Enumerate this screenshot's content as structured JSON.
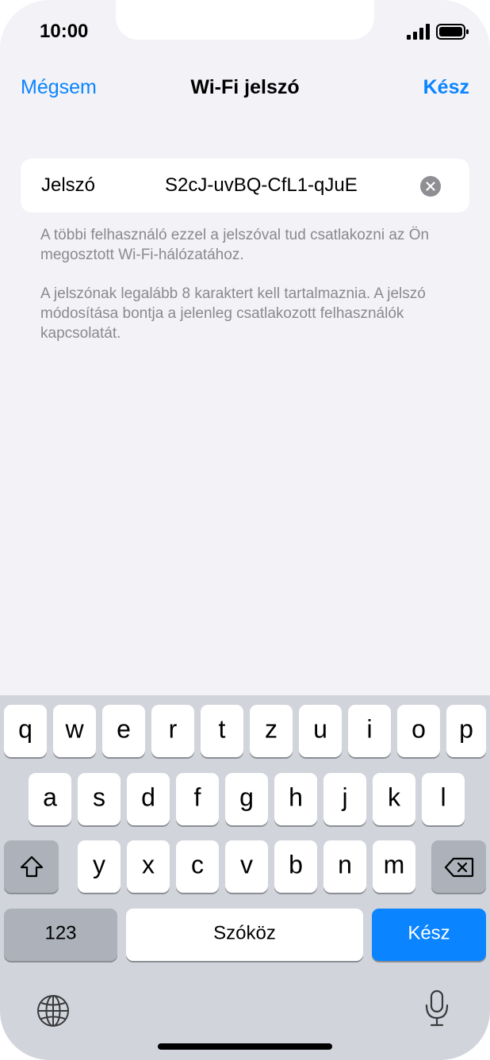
{
  "status_bar": {
    "time": "10:00"
  },
  "nav": {
    "cancel": "Mégsem",
    "title": "Wi-Fi jelszó",
    "done": "Kész"
  },
  "password_field": {
    "label": "Jelszó",
    "value": "S2cJ-uvBQ-CfL1-qJuE"
  },
  "footnotes": [
    "A többi felhasználó ezzel a jelszóval tud csatlakozni az Ön megosztott Wi-Fi-hálózatához.",
    "A jelszónak legalább 8 karaktert kell tartalmaznia. A jelszó módosítása bontja a jelenleg csatlakozott felhasználók kapcsolatát."
  ],
  "keyboard": {
    "row1": [
      "q",
      "w",
      "e",
      "r",
      "t",
      "z",
      "u",
      "i",
      "o",
      "p"
    ],
    "row2": [
      "a",
      "s",
      "d",
      "f",
      "g",
      "h",
      "j",
      "k",
      "l"
    ],
    "row3": [
      "y",
      "x",
      "c",
      "v",
      "b",
      "n",
      "m"
    ],
    "numbers": "123",
    "space": "Szóköz",
    "return": "Kész"
  },
  "icons": {
    "shift": "shift-icon",
    "delete": "backspace-icon",
    "globe": "globe-icon",
    "mic": "microphone-icon",
    "clear": "clear-icon"
  },
  "colors": {
    "accent": "#0a84ff",
    "background": "#f2f2f7",
    "keyboard": "#d1d4db"
  }
}
